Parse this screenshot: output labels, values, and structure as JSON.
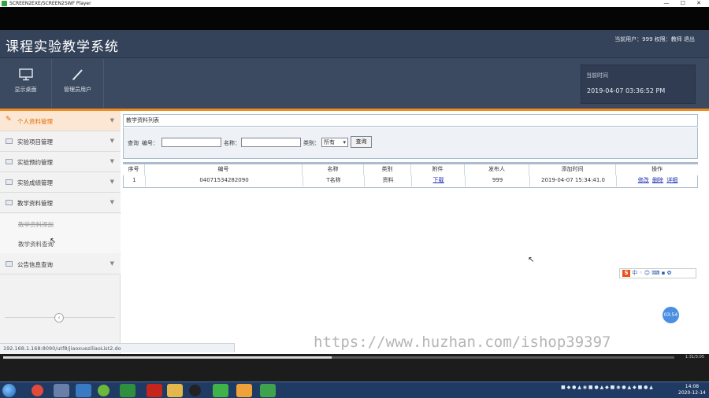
{
  "player": {
    "title": "SCREEN2EXE/SCREEN2SWF Player",
    "controls": "— ☐ ✕"
  },
  "header": {
    "title": "课程实验教学系统",
    "user_info": "当前用户：999 权限：教师 退出",
    "nav": [
      {
        "label": "显示桌面",
        "icon": "monitor-icon"
      },
      {
        "label": "管理员用户",
        "icon": "pencil-icon"
      }
    ],
    "time_label": "当前时间",
    "time_value": "2019-04-07 03:36:52 PM"
  },
  "sidebar": {
    "menus": [
      {
        "label": "个人资料管理",
        "active": true
      },
      {
        "label": "实验项目管理"
      },
      {
        "label": "实验预约管理"
      },
      {
        "label": "实验成绩管理"
      },
      {
        "label": "教学资料管理"
      },
      {
        "label": "公告信息查询"
      }
    ],
    "subitems": [
      "教学资料添加",
      "教学资料查询"
    ],
    "collapse": "‹"
  },
  "content": {
    "panel_title": "教学资料列表",
    "search": {
      "prefix": "查询",
      "number_label": "编号：",
      "name_label": "名称：",
      "category_label": "类别：",
      "category_value": "所有",
      "button": "查询"
    },
    "table": {
      "headers": [
        "序号",
        "编号",
        "名称",
        "类别",
        "附件",
        "发布人",
        "添加时间",
        "操作"
      ],
      "rows": [
        {
          "index": "1",
          "number": "04071534282090",
          "name": "T名称",
          "category": "资料",
          "attachment": "下载",
          "publisher": "999",
          "time": "2019-04-07 15:34:41.0",
          "ops": [
            "修改",
            "删除",
            "详细"
          ]
        }
      ]
    }
  },
  "status_url": "192.168.1.168:8090/utf8/jiaoxueziliaoList2.do",
  "timer_badge": "03:54",
  "watermark": "https://www.huzhan.com/ishop39397",
  "seek": {
    "progress": 0.49,
    "time": "1:31/3:05"
  },
  "taskbar": {
    "clock_time": "14:08",
    "clock_date": "2020-12-14"
  },
  "colors": {
    "header_bg": "#3b4a60",
    "accent": "#f28a1e",
    "link": "#1a2fb5"
  }
}
